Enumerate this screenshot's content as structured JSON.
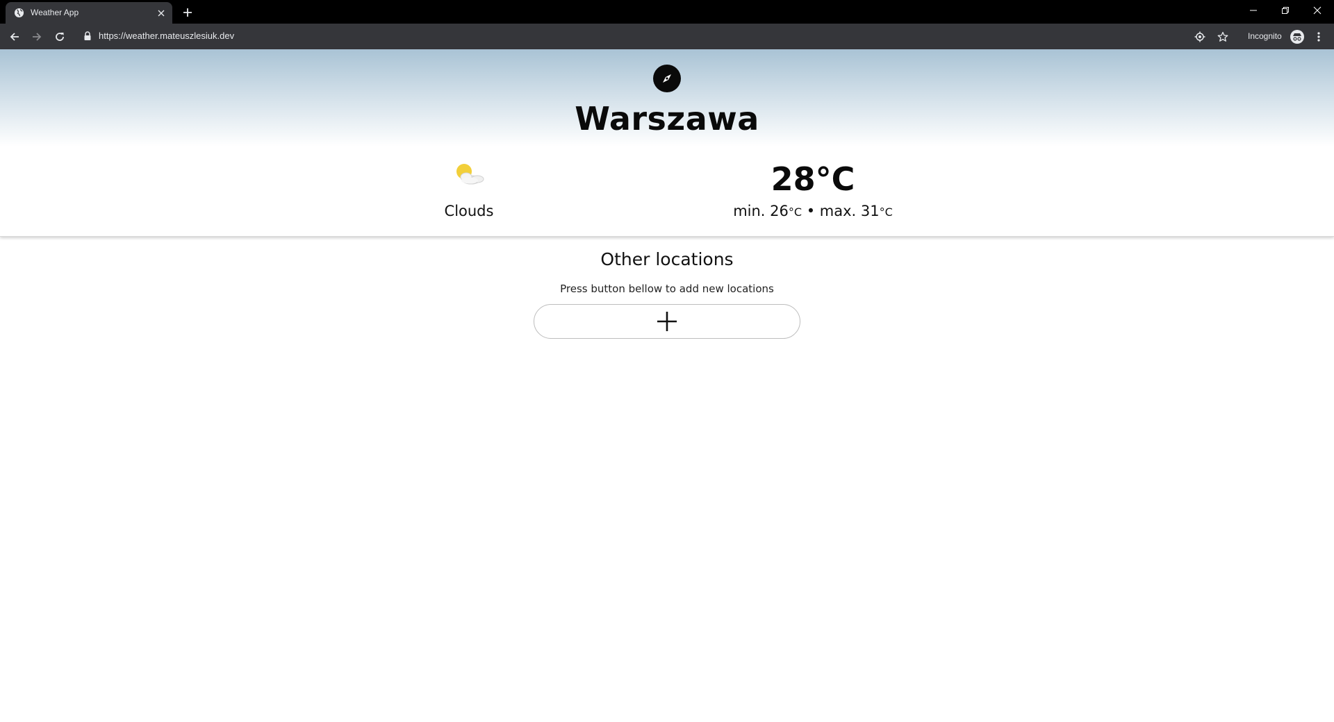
{
  "browser": {
    "tab_title": "Weather App",
    "url": "https://weather.mateuszlesiuk.dev",
    "profile_label": "Incognito",
    "icons": {
      "favicon": "globe-icon",
      "tab_close": "close-icon",
      "new_tab": "plus-icon",
      "back": "arrow-left-icon",
      "forward": "arrow-right-icon",
      "reload": "reload-icon",
      "lock": "lock-icon",
      "location": "location-target-icon",
      "bookmark": "star-icon",
      "incognito": "incognito-icon",
      "menu": "kebab-menu-icon",
      "minimize": "minimize-icon",
      "maximize": "restore-icon",
      "close_window": "close-icon"
    }
  },
  "weather": {
    "locate_icon": "compass-icon",
    "city": "Warszawa",
    "condition": "Clouds",
    "condition_icon": "sun-behind-clouds-icon",
    "temperature": "28°C",
    "min_label": "min. 26",
    "min_unit": "°C",
    "separator": " • ",
    "max_label": "max. 31",
    "max_unit": "°C"
  },
  "other_locations": {
    "title": "Other locations",
    "hint": "Press button bellow to add new locations",
    "add_icon": "plus-icon"
  },
  "colors": {
    "hero_top": "#a9c3d5",
    "text": "#0a0a0a",
    "chrome_bg": "#35363a",
    "tabstrip_bg": "#000000"
  }
}
